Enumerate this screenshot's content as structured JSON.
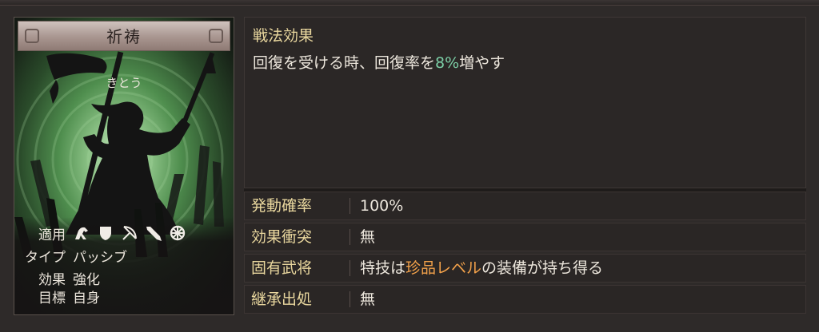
{
  "card": {
    "title": "祈祷",
    "reading": "きとう",
    "stats": {
      "target_label": "適用",
      "target_icons": [
        "cavalry-icon",
        "shield-icon",
        "bow-icon",
        "spear-icon",
        "wheel-icon"
      ],
      "type_label": "タイプ",
      "type_value": "パッシブ",
      "effect_label": "効果",
      "effect_value": "強化",
      "goal_label": "目標",
      "goal_value": "自身"
    }
  },
  "effect": {
    "heading": "戦法効果",
    "desc_prefix": "回復を受ける時、回復率を",
    "desc_value": "8%",
    "desc_suffix": "増やす"
  },
  "rows": {
    "rate_label": "発動確率",
    "rate_value": "100%",
    "conflict_label": "効果衝突",
    "conflict_value": "無",
    "unique_label": "固有武将",
    "unique_prefix": "特技は",
    "unique_highlight": "珍品レベル",
    "unique_suffix": "の装備が持ち得る",
    "inherit_label": "継承出処",
    "inherit_value": "無"
  },
  "colors": {
    "label_gold": "#e9d79e",
    "value_green": "#7ccfa6",
    "highlight_orange": "#f2a14a"
  }
}
